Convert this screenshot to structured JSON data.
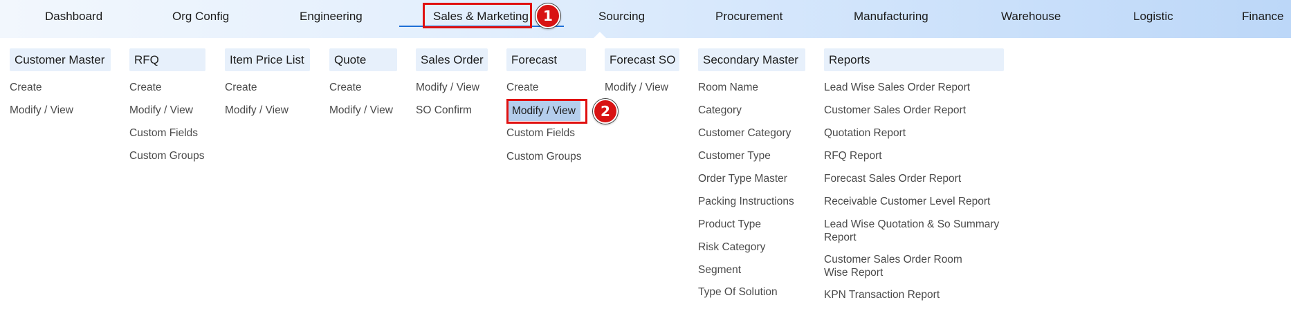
{
  "nav": {
    "items": [
      {
        "label": "Dashboard"
      },
      {
        "label": "Org Config"
      },
      {
        "label": "Engineering"
      },
      {
        "label": "Sales & Marketing"
      },
      {
        "label": "Sourcing"
      },
      {
        "label": "Procurement"
      },
      {
        "label": "Manufacturing"
      },
      {
        "label": "Warehouse"
      },
      {
        "label": "Logistic"
      },
      {
        "label": "Finance"
      }
    ]
  },
  "annotations": {
    "step1": "1",
    "step2": "2"
  },
  "menu": {
    "columns": [
      {
        "header": "Customer Master",
        "items": [
          "Create",
          "Modify / View"
        ]
      },
      {
        "header": "RFQ",
        "items": [
          "Create",
          "Modify / View",
          "Custom Fields",
          "Custom Groups"
        ]
      },
      {
        "header": "Item Price List",
        "items": [
          "Create",
          "Modify / View"
        ]
      },
      {
        "header": "Quote",
        "items": [
          "Create",
          "Modify / View"
        ]
      },
      {
        "header": "Sales Order",
        "items": [
          "Modify / View",
          "SO Confirm"
        ]
      },
      {
        "header": "Forecast",
        "items": [
          "Create",
          "Modify / View",
          "Custom Fields",
          "Custom Groups"
        ]
      },
      {
        "header": "Forecast SO",
        "items": [
          "Modify / View"
        ]
      },
      {
        "header": "Secondary Master",
        "items": [
          "Room Name",
          "Category",
          "Customer Category",
          "Customer Type",
          "Order Type Master",
          "Packing Instructions",
          "Product Type",
          "Risk Category",
          "Segment",
          "Type Of Solution"
        ]
      },
      {
        "header": "Reports",
        "items": [
          "Lead Wise Sales Order Report",
          "Customer Sales Order Report",
          "Quotation Report",
          "RFQ Report",
          "Forecast Sales Order Report",
          "Receivable Customer Level Report",
          "Lead Wise Quotation & So Summary Report",
          "Customer Sales Order Room Wise Report",
          "KPN Transaction Report"
        ]
      }
    ]
  },
  "colors": {
    "accent": "#1e6fd6",
    "highlight": "#e01010",
    "active_item_bg": "#b4cdec",
    "header_bg": "#e7f0fb"
  }
}
